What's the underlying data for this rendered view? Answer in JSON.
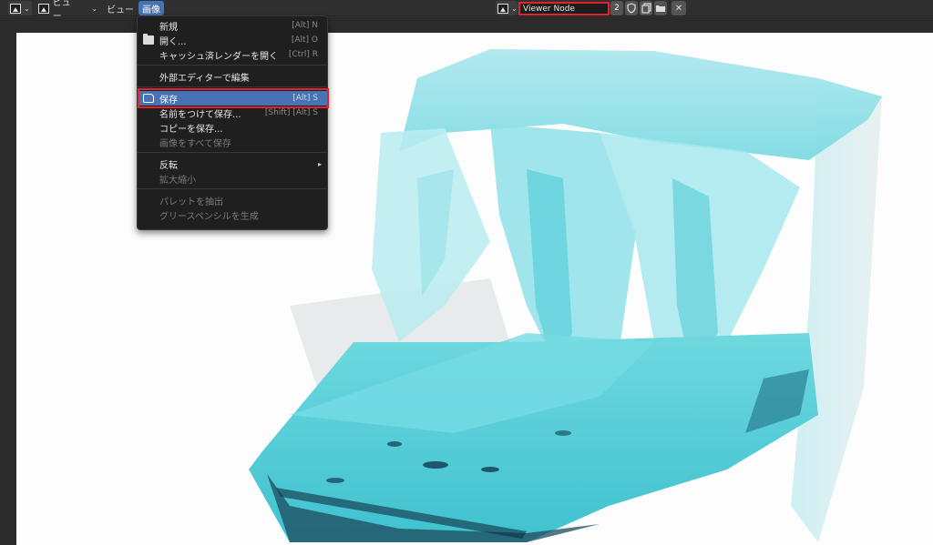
{
  "header": {
    "editor_type_icon": "image-editor-icon",
    "view_mode_label": "ビュー",
    "view_menu_label": "ビュー",
    "image_menu_label": "画像",
    "image_name": "Viewer Node",
    "users_count": "2",
    "fake_user_icon": "shield-icon",
    "new_image_icon": "duplicate-icon",
    "open_image_icon": "folder-icon",
    "unlink_icon": "close-icon"
  },
  "menu": {
    "new": {
      "label": "新規",
      "shortcut": "[Alt] N"
    },
    "open": {
      "label": "開く...",
      "shortcut": "[Alt] O"
    },
    "open_cached": {
      "label": "キャッシュ済レンダーを開く",
      "shortcut": "[Ctrl] R"
    },
    "edit_external": {
      "label": "外部エディターで編集"
    },
    "save": {
      "label": "保存",
      "shortcut": "[Alt] S"
    },
    "save_as": {
      "label": "名前をつけて保存...",
      "shortcut": "[Shift] [Alt] S"
    },
    "save_copy": {
      "label": "コピーを保存..."
    },
    "save_all": {
      "label": "画像をすべて保存"
    },
    "flip": {
      "label": "反転"
    },
    "resize": {
      "label": "拡大縮小"
    },
    "extract_palette": {
      "label": "パレットを抽出"
    },
    "gen_grease_pencil": {
      "label": "グリースペンシルを生成"
    }
  },
  "colors": {
    "accent": "#4772b3",
    "highlight_box": "#e1232b",
    "water": "#5fd4dc"
  }
}
